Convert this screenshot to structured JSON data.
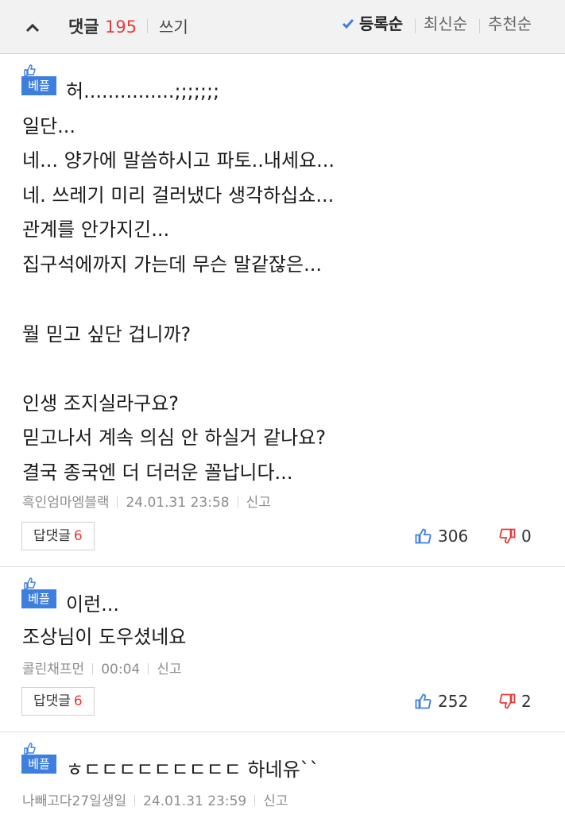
{
  "header": {
    "comment_label": "댓글",
    "comment_count": "195",
    "write_label": "쓰기",
    "sort_options": [
      "등록순",
      "최신순",
      "추천순"
    ],
    "active_sort": "등록순",
    "accent_color": "#3d7fdf",
    "count_color": "#e23c3c"
  },
  "best_badge_label": "베플",
  "comments": [
    {
      "lines": [
        "허...............;;;;;;;",
        "일단...",
        "네... 양가에 말씀하시고 파토..내세요...",
        "네. 쓰레기 미리 걸러냈다 생각하십쇼...",
        "관계를 안가지긴...",
        "집구석에까지 가는데 무슨 말같잖은...",
        "",
        "뭘 믿고 싶단 겁니까?",
        "",
        "인생 조지실라구요?",
        "믿고나서 계속 의심 안 하실거 같나요?",
        "결국 종국엔 더 더러운 꼴납니다..."
      ],
      "author": "흑인엄마엠블랙",
      "timestamp": "24.01.31 23:58",
      "report_label": "신고",
      "reply_label": "답댓글",
      "reply_count": "6",
      "likes": "306",
      "dislikes": "0"
    },
    {
      "lines": [
        "이런...",
        "조상님이 도우셨네요"
      ],
      "author": "콜린채프먼",
      "timestamp": "00:04",
      "report_label": "신고",
      "reply_label": "답댓글",
      "reply_count": "6",
      "likes": "252",
      "dislikes": "2"
    },
    {
      "lines": [
        "ㅎㄷㄷㄷㄷㄷㄷㄷㄷㄷ 하네유``"
      ],
      "author": "나빼고다27일생일",
      "timestamp": "24.01.31 23:59",
      "report_label": "신고"
    }
  ]
}
